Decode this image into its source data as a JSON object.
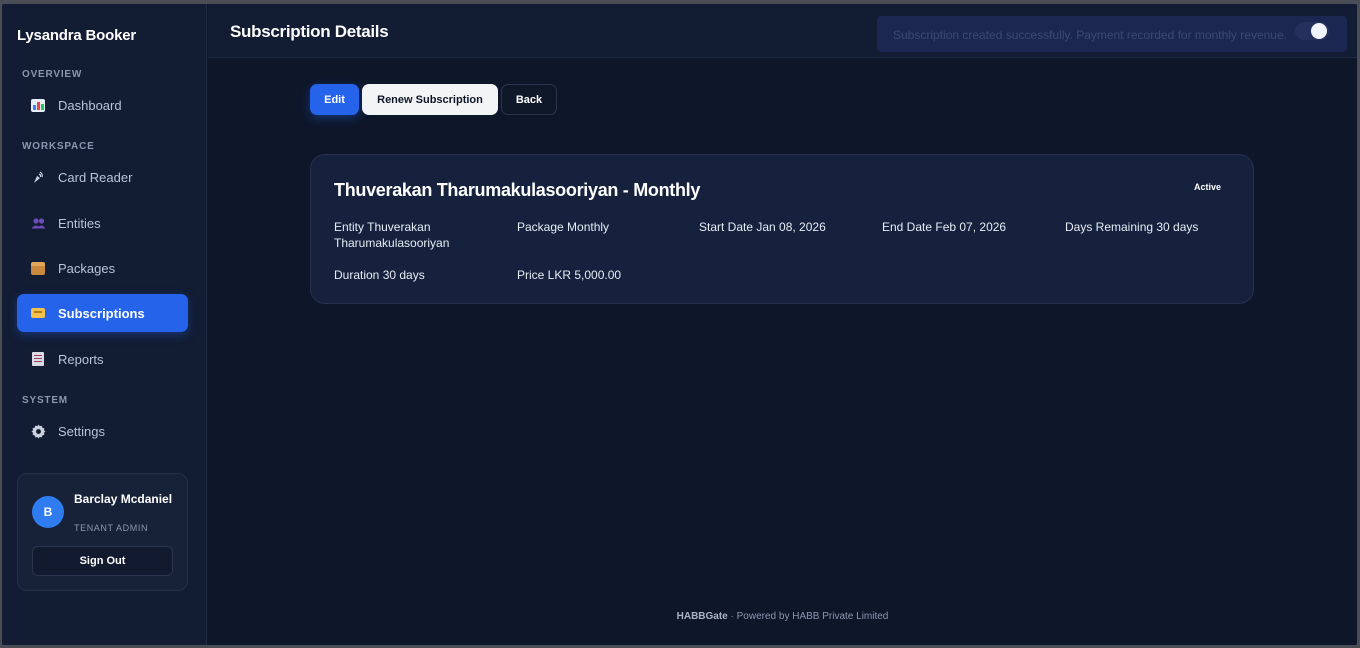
{
  "sidebar": {
    "brand": "Lysandra Booker",
    "sections": {
      "overview": "OVERVIEW",
      "workspace": "WORKSPACE",
      "system": "SYSTEM"
    },
    "items": [
      {
        "label": "Dashboard",
        "icon": "dashboard-chart-icon"
      },
      {
        "label": "Card Reader",
        "icon": "card-reader-icon"
      },
      {
        "label": "Entities",
        "icon": "people-icon"
      },
      {
        "label": "Packages",
        "icon": "package-box-icon"
      },
      {
        "label": "Subscriptions",
        "icon": "ticket-icon",
        "active": true
      },
      {
        "label": "Reports",
        "icon": "report-document-icon"
      },
      {
        "label": "Settings",
        "icon": "gear-icon"
      }
    ],
    "user": {
      "initial": "B",
      "name": "Barclay Mcdaniel",
      "role": "TENANT ADMIN",
      "signout_label": "Sign Out"
    }
  },
  "header": {
    "title": "Subscription Details"
  },
  "toast": {
    "message": "Subscription created successfully. Payment recorded for monthly revenue."
  },
  "actions": {
    "edit_label": "Edit",
    "renew_label": "Renew Subscription",
    "back_label": "Back"
  },
  "subscription": {
    "title": "Thuverakan Tharumakulasooriyan - Monthly",
    "status": "Active",
    "fields": {
      "entity": "Entity Thuverakan Tharumakulasooriyan",
      "package": "Package Monthly",
      "start_date": "Start Date Jan 08, 2026",
      "end_date": "End Date Feb 07, 2026",
      "days_remaining": "Days Remaining 30 days",
      "duration": "Duration 30 days",
      "price": "Price LKR 5,000.00"
    }
  },
  "footer": {
    "brand": "HABBGate",
    "text": " · Powered by HABB Private Limited"
  },
  "colors": {
    "accent": "#2563eb",
    "background": "#0e1629",
    "sidebar": "#121c33",
    "card": "#16223d"
  }
}
